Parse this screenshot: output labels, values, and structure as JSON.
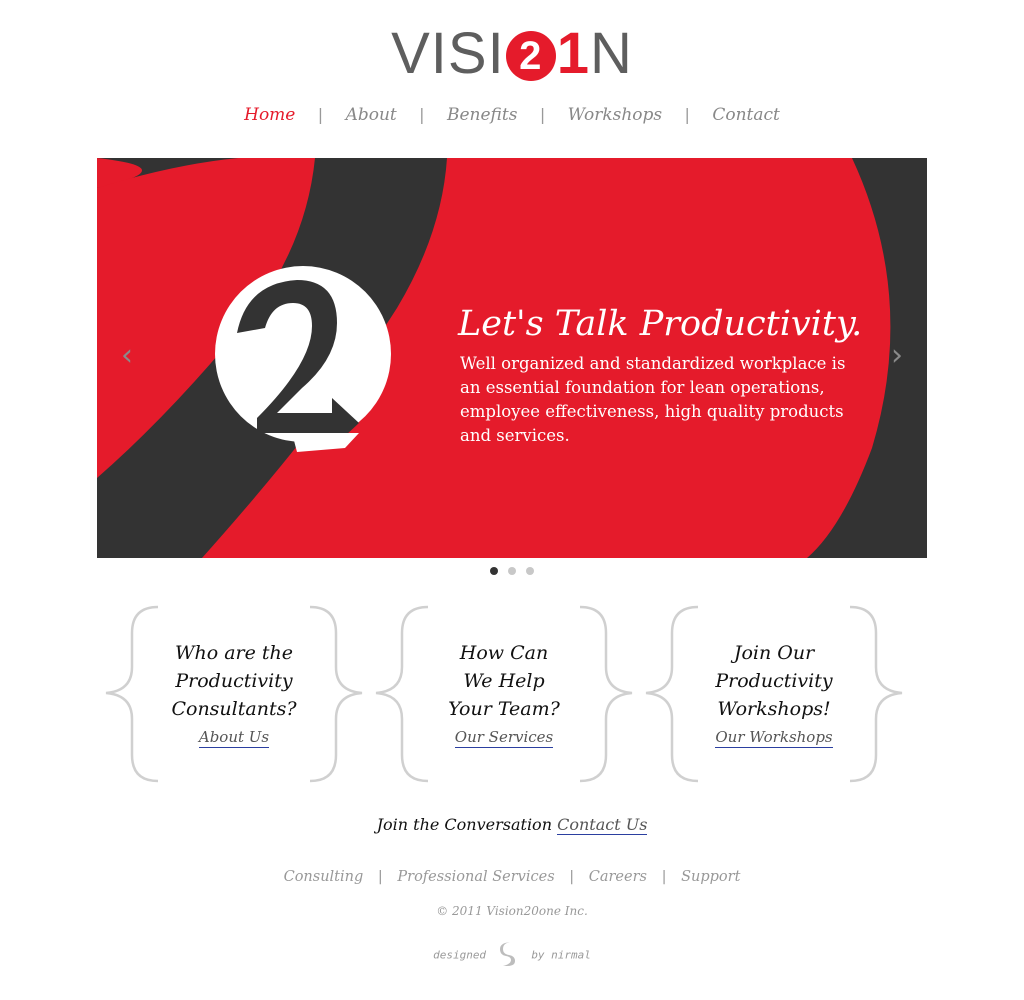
{
  "logo": {
    "part1": "VISI",
    "part2": "2",
    "part3": "1",
    "part4": "N"
  },
  "nav": {
    "items": [
      {
        "label": "Home",
        "active": true
      },
      {
        "label": "About"
      },
      {
        "label": "Benefits"
      },
      {
        "label": "Workshops"
      },
      {
        "label": "Contact"
      }
    ],
    "separator": "|"
  },
  "hero": {
    "headline": "Let's Talk Productivity.",
    "body": "Well organized and standardized workplace is an essential foundation for lean operations, employee effectiveness, high quality products and services.",
    "prev_arrow": "‹",
    "next_arrow": "›",
    "slide_count": 3,
    "active_slide": 1,
    "colors": {
      "red": "#e51b2b",
      "dark": "#333333",
      "white": "#ffffff"
    }
  },
  "features": [
    {
      "title_lines": [
        "Who are the",
        "Productivity",
        "Consultants?"
      ],
      "link": "About Us"
    },
    {
      "title_lines": [
        "How Can",
        "We Help",
        "Your Team?"
      ],
      "link": "Our Services"
    },
    {
      "title_lines": [
        "Join Our",
        "Productivity",
        "Workshops!"
      ],
      "link": "Our Workshops"
    }
  ],
  "conversation": {
    "text": "Join the Conversation",
    "link": "Contact Us"
  },
  "footer": {
    "links": [
      "Consulting",
      "Professional Services",
      "Careers",
      "Support"
    ],
    "separator": "|",
    "copyright": "© 2011 Vision20one Inc.",
    "credit_left": "designed",
    "credit_right": "by nirmal"
  },
  "colors": {
    "accent": "#e51b2b",
    "link_underline": "#2b3fa0",
    "muted": "#999999"
  }
}
